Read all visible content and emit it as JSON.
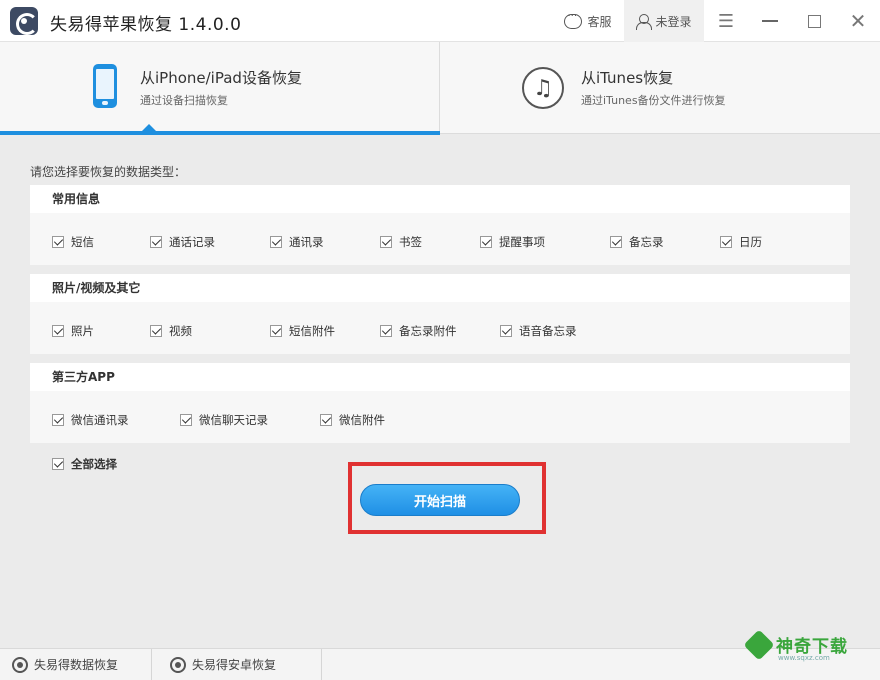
{
  "window": {
    "title": "失易得苹果恢复  1.4.0.0",
    "service_label": "客服",
    "login_label": "未登录",
    "menu_glyph": "☰",
    "close_glyph": "✕"
  },
  "modes": {
    "device": {
      "title": "从iPhone/iPad设备恢复",
      "subtitle": "通过设备扫描恢复"
    },
    "itunes": {
      "title": "从iTunes恢复",
      "subtitle": "通过iTunes备份文件进行恢复",
      "icon_glyph": "♫"
    }
  },
  "prompt": "请您选择要恢复的数据类型：",
  "groups": [
    {
      "title": "常用信息",
      "items": [
        "短信",
        "通话记录",
        "通讯录",
        "书签",
        "提醒事项",
        "备忘录",
        "日历"
      ]
    },
    {
      "title": "照片/视频及其它",
      "items": [
        "照片",
        "视频",
        "短信附件",
        "备忘录附件",
        "语音备忘录"
      ]
    },
    {
      "title": "第三方APP",
      "items": [
        "微信通讯录",
        "微信聊天记录",
        "微信附件"
      ]
    }
  ],
  "select_all_label": "全部选择",
  "start_button_label": "开始扫描",
  "bottom": {
    "item1": "失易得数据恢复",
    "item2": "失易得安卓恢复"
  },
  "watermark": {
    "text": "神奇下载",
    "sub": "www.sqxz.com"
  },
  "colors": {
    "accent": "#1e8fdf",
    "highlight": "#e03131",
    "watermark": "#3aa63c"
  },
  "icons": [
    "app-logo-icon",
    "chat-icon",
    "user-icon",
    "menu-icon",
    "minimize-icon",
    "maximize-icon",
    "close-icon",
    "phone-icon",
    "itunes-icon",
    "checkbox-checked"
  ]
}
